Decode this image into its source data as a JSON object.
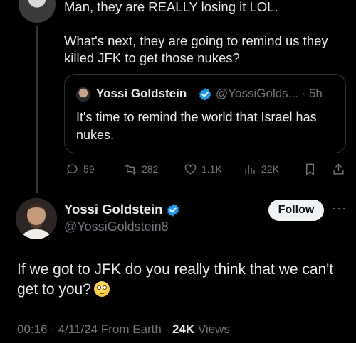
{
  "reply_tweet": {
    "text_line1": "Man, they are REALLY losing it LOL.",
    "text_line2": "What's next, they are going to remind us they killed JFK to get those nukes?",
    "quote": {
      "name": "Yossi Goldstein",
      "handle_time": "@YossiGolds... · 5h",
      "text": "It's time to remind the world that Israel has nukes."
    },
    "actions": {
      "replies": "59",
      "reposts": "282",
      "likes": "1.1K",
      "views": "22K"
    }
  },
  "main_tweet": {
    "name": "Yossi Goldstein",
    "handle": "@YossiGoldstein8",
    "follow_label": "Follow",
    "more_label": "···",
    "text": "If we got to JFK do you really think that we can't get to you?",
    "emoji": "face-with-rolling-eyes",
    "meta_prefix": "00:16 · 4/11/24 From Earth · ",
    "views_count": "24K",
    "views_label": " Views"
  },
  "colors": {
    "background": "#000000",
    "text": "#e7e9ea",
    "muted": "#71767b",
    "verified": "#1d9bf0",
    "border": "#2f3336"
  }
}
